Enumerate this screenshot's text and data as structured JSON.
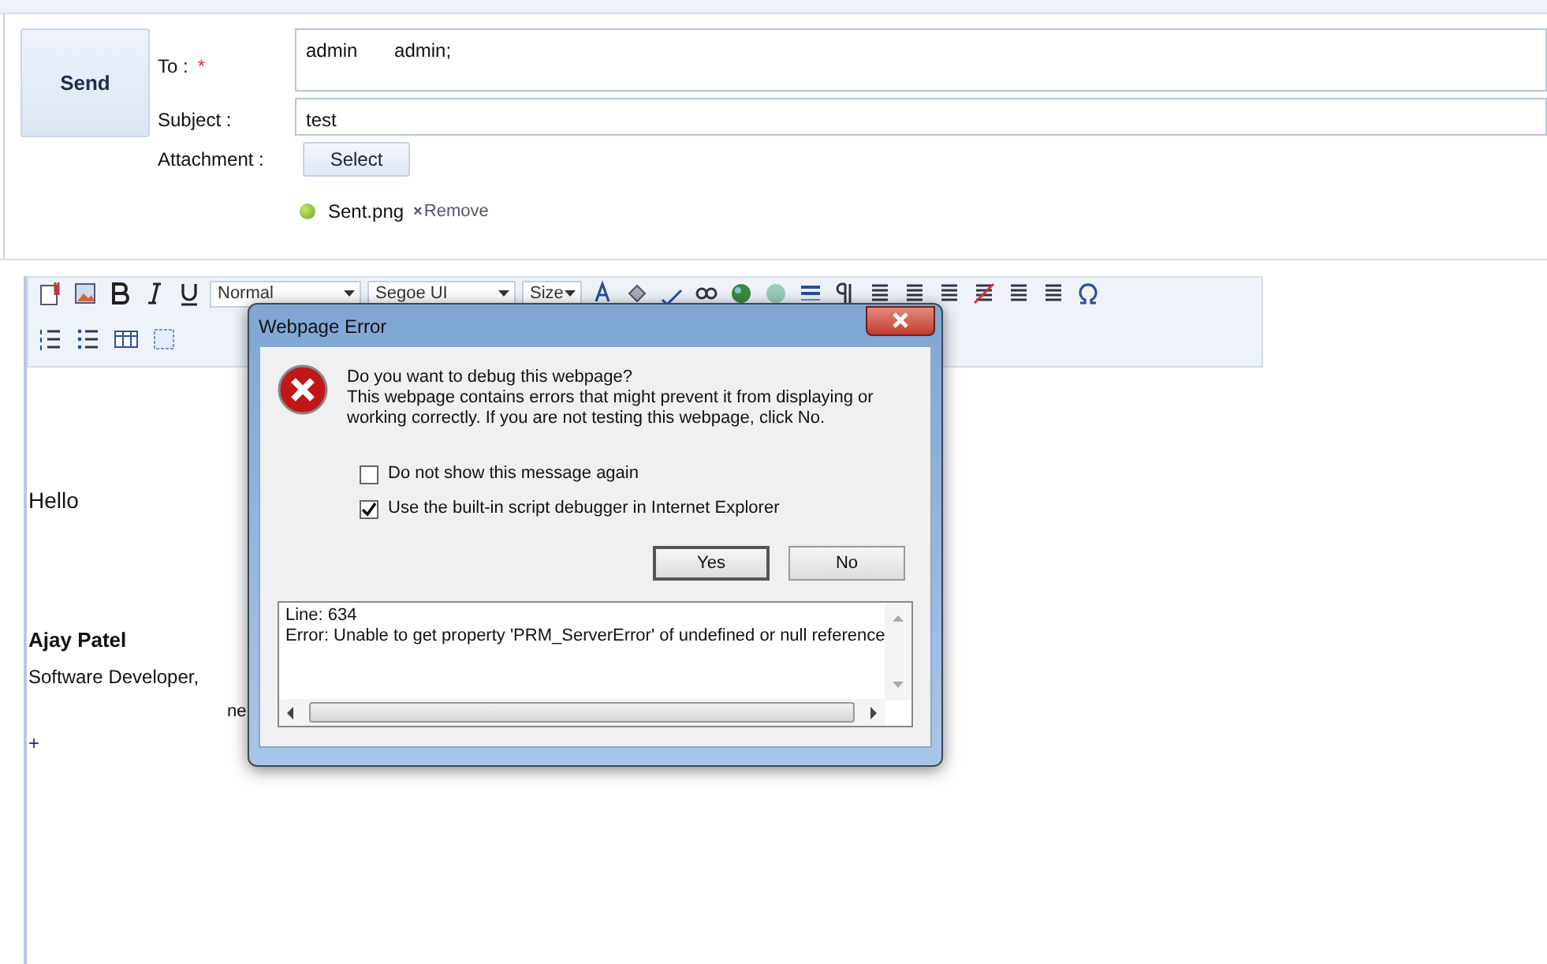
{
  "compose": {
    "send_button": "Send",
    "fields": [
      {
        "label": "To :",
        "required_mark": "*",
        "value": "admin       admin;",
        "kind": "multiline"
      },
      {
        "label": "Subject :",
        "value": "test",
        "kind": "line"
      }
    ],
    "attachment": {
      "label": "Attachment :",
      "button": "Select",
      "file": "Sent.png",
      "remove": "Remove",
      "remove_icon": "×"
    }
  },
  "toolbar": {
    "dropdowns": [
      "Normal",
      "Segoe UI",
      "Size"
    ]
  },
  "editor": {
    "lines": [
      {
        "text": "Hello",
        "kind": "plain"
      },
      {
        "text": "Ajay Patel",
        "kind": "bold"
      },
      {
        "text": "Software Developer,",
        "kind": "plain"
      },
      {
        "text": "ne",
        "kind": "partial"
      },
      {
        "text": "+",
        "kind": "marker"
      }
    ]
  },
  "dialog": {
    "title": "Webpage Error",
    "question": "Do you want to debug this webpage?",
    "message": "This webpage contains errors that might prevent it from displaying or working correctly. If you are not testing this webpage, click No.",
    "options": [
      {
        "label": "Do not show this message again",
        "checked": false
      },
      {
        "label": "Use the built-in script debugger in Internet Explorer",
        "checked": true
      }
    ],
    "buttons": [
      {
        "label": "Yes",
        "selected": true
      },
      {
        "label": "No",
        "selected": false
      }
    ],
    "details": [
      "Line: 634",
      "Error: Unable to get property 'PRM_ServerError' of undefined or null reference"
    ]
  }
}
